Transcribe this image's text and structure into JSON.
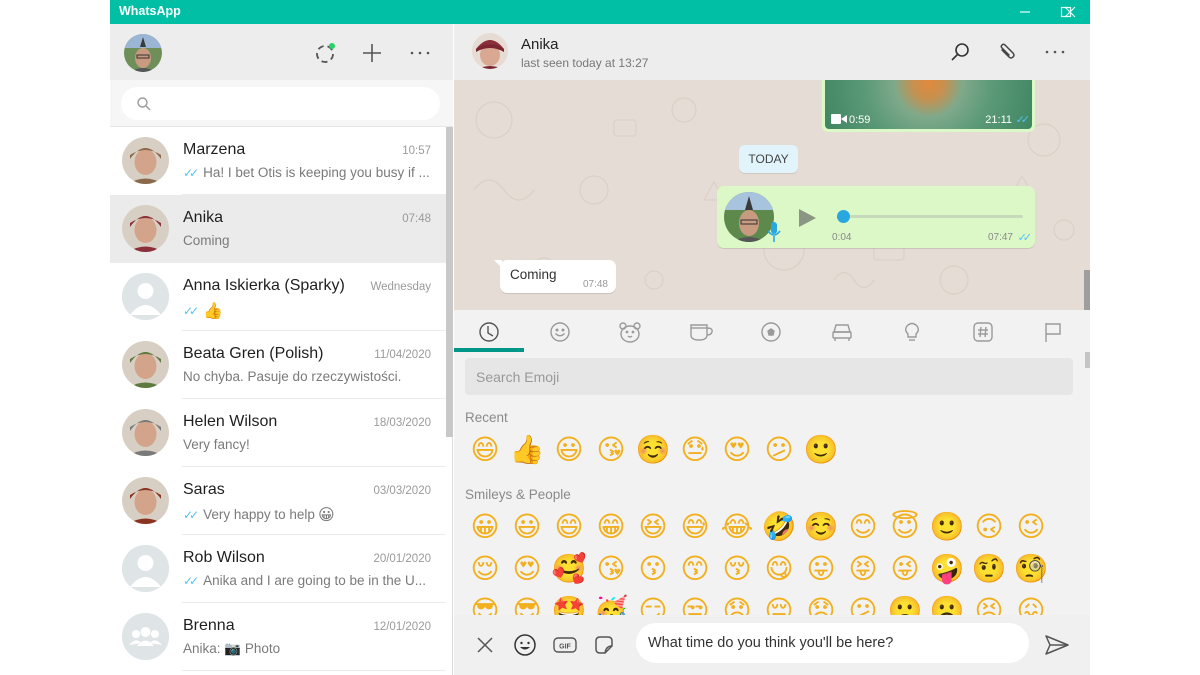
{
  "window": {
    "title": "WhatsApp",
    "controls": {
      "minimize": "minimize-icon",
      "maximize": "maximize-icon",
      "close": "close-icon"
    }
  },
  "sidebar": {
    "header_icons": [
      "status-icon",
      "new-chat-icon",
      "menu-icon"
    ],
    "search": {
      "placeholder": "",
      "value": ""
    },
    "chats": [
      {
        "name": "Marzena",
        "time": "10:57",
        "ticks": true,
        "preview": "Ha! I bet Otis is keeping you busy if ...",
        "avatar": "photo",
        "avatar_color": "#8a6a4a",
        "active": false
      },
      {
        "name": "Anika",
        "time": "07:48",
        "ticks": false,
        "preview": "Coming",
        "avatar": "photo",
        "avatar_color": "#8b2f3a",
        "active": true
      },
      {
        "name": "Anna Iskierka (Sparky)",
        "time": "Wednesday",
        "ticks": true,
        "preview": "",
        "preview_emoji": "👍",
        "avatar": "placeholder",
        "active": false
      },
      {
        "name": "Beata Gren (Polish)",
        "time": "11/04/2020",
        "ticks": false,
        "preview": "No chyba. Pasuje do rzeczywistości.",
        "avatar": "photo",
        "avatar_color": "#5e7a3e",
        "active": false
      },
      {
        "name": "Helen Wilson",
        "time": "18/03/2020",
        "ticks": false,
        "preview": "Very fancy!",
        "avatar": "photo",
        "avatar_color": "#7a7a7a",
        "active": false
      },
      {
        "name": "Saras",
        "time": "03/03/2020",
        "ticks": true,
        "preview": "Very happy to help",
        "preview_emoji": "😀",
        "avatar": "photo",
        "avatar_color": "#8a3320",
        "active": false
      },
      {
        "name": "Rob Wilson",
        "time": "20/01/2020",
        "ticks": true,
        "preview": "Anika and I are going to be in the U...",
        "avatar": "placeholder",
        "active": false
      },
      {
        "name": "Brenna",
        "time": "12/01/2020",
        "ticks": false,
        "preview": "Anika: 📷 Photo",
        "avatar": "group-placeholder",
        "active": false
      }
    ]
  },
  "chat": {
    "contact_name": "Anika",
    "status": "last seen today at 13:27",
    "header_icons": [
      "search-icon",
      "attach-icon",
      "menu-icon"
    ],
    "messages": {
      "video": {
        "duration": "0:59",
        "time": "21:11",
        "read": true
      },
      "date_chip": "TODAY",
      "voice": {
        "duration": "0:04",
        "time": "07:47",
        "read": true,
        "progress": 0
      },
      "incoming": {
        "text": "Coming",
        "time": "07:48"
      }
    }
  },
  "emoji_panel": {
    "tabs": [
      "recent",
      "smileys",
      "animals",
      "food",
      "activity",
      "travel",
      "objects",
      "symbols",
      "flags"
    ],
    "active_tab": "recent",
    "search_placeholder": "Search Emoji",
    "sections": [
      {
        "label": "Recent",
        "rows": [
          [
            "😄",
            "👍",
            "😃",
            "😘",
            "☺️",
            "😓",
            "😍",
            "😕",
            "🙂"
          ]
        ]
      },
      {
        "label": "Smileys & People",
        "rows": [
          [
            "😀",
            "😃",
            "😄",
            "😁",
            "😆",
            "😅",
            "😂",
            "🤣",
            "☺️",
            "😊",
            "😇",
            "🙂",
            "🙃",
            "😉"
          ],
          [
            "😌",
            "😍",
            "🥰",
            "😘",
            "😗",
            "😙",
            "😚",
            "😋",
            "😛",
            "😝",
            "😜",
            "🤪",
            "🤨",
            "🧐"
          ],
          [
            "😎",
            "😎",
            "🤩",
            "🥳",
            "😏",
            "😒",
            "😞",
            "😔",
            "😟",
            "😕",
            "🙁",
            "☹️",
            "😣",
            "😖"
          ]
        ]
      }
    ]
  },
  "composer": {
    "icons": [
      "close-icon",
      "emoji-icon",
      "gif-icon",
      "sticker-icon"
    ],
    "message_value": "What time do you think you'll be here?",
    "send_icon": "send-icon"
  }
}
